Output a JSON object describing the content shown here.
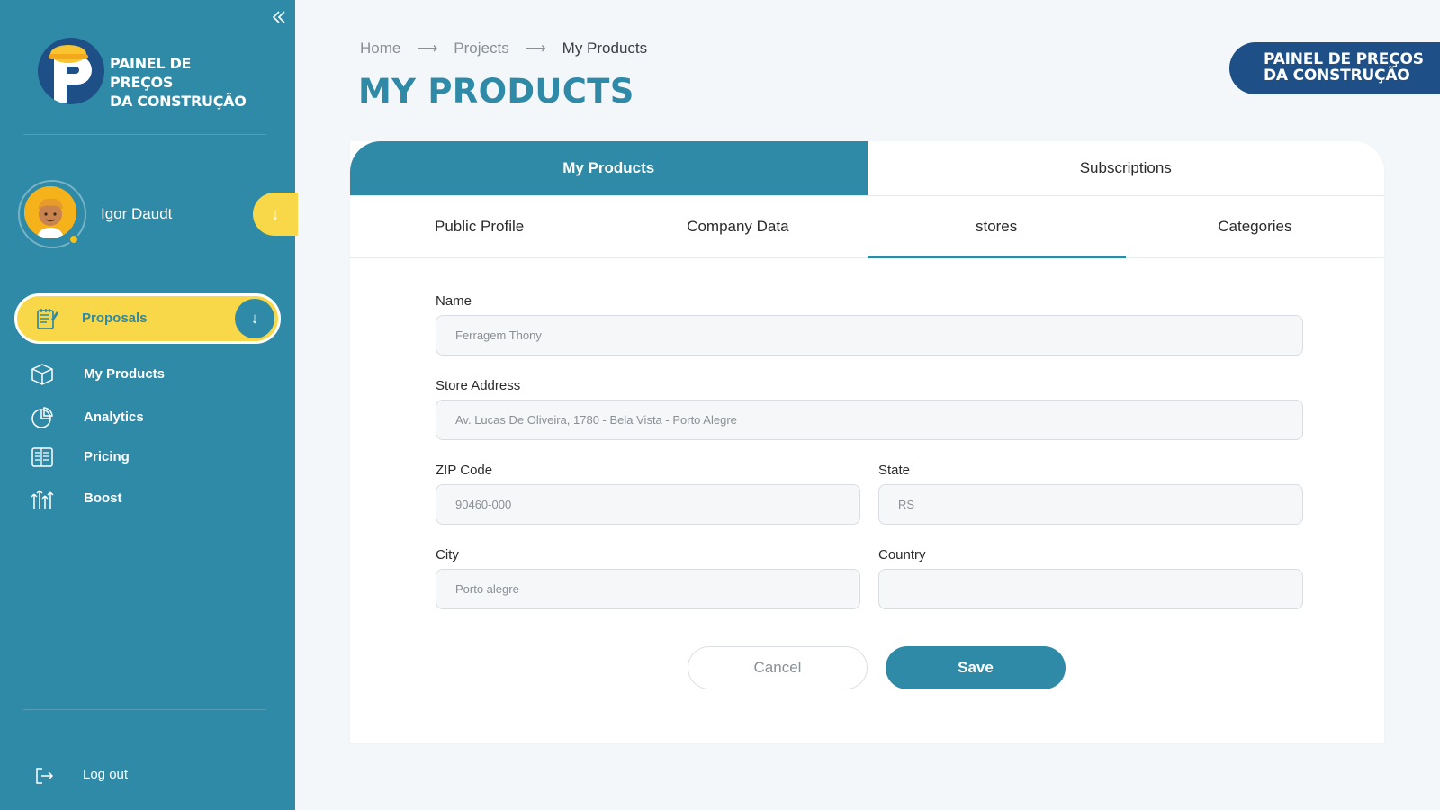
{
  "brand": {
    "logo_line1": "PAINEL DE PREÇOS",
    "logo_line2": "DA CONSTRUÇÃO",
    "badge_line1": "PAINEL DE PREÇOS",
    "badge_line2": "DA CONSTRUÇÃO",
    "colors": {
      "primary": "#2e8aa6",
      "accent": "#f8d848",
      "navy": "#1e4f86"
    }
  },
  "sidebar": {
    "collapse_icon": "double-chevron-left-icon",
    "user": {
      "name": "Igor Daudt",
      "toggle_icon": "arrow-down-icon"
    },
    "active_item": {
      "label": "Proposals",
      "icon": "notepad-icon",
      "arrow_icon": "arrow-down-icon"
    },
    "items": [
      {
        "label": "My Products",
        "icon": "box-icon"
      },
      {
        "label": "Analytics",
        "icon": "pie-chart-icon"
      },
      {
        "label": "Pricing",
        "icon": "price-list-icon"
      },
      {
        "label": "Boost",
        "icon": "boost-icon"
      }
    ],
    "logout": {
      "label": "Log out",
      "icon": "logout-icon"
    }
  },
  "header": {
    "breadcrumb": [
      "Home",
      "Projects",
      "My Products"
    ],
    "title": "MY PRODUCTS"
  },
  "tabs": {
    "main": [
      "My Products",
      "Subscriptions"
    ],
    "main_active": "My Products",
    "sub": [
      "Public Profile",
      "Company Data",
      "stores",
      "Categories"
    ],
    "sub_active": "stores"
  },
  "form": {
    "name": {
      "label": "Name",
      "value": "Ferragem Thony"
    },
    "address": {
      "label": "Store Address",
      "value": "Av. Lucas De Oliveira, 1780 - Bela Vista - Porto Alegre"
    },
    "zip": {
      "label": "ZIP Code",
      "value": "90460-000"
    },
    "state": {
      "label": "State",
      "value": "RS"
    },
    "city": {
      "label": "City",
      "value": "Porto alegre"
    },
    "country": {
      "label": "Country",
      "value": ""
    },
    "cancel_label": "Cancel",
    "save_label": "Save"
  }
}
